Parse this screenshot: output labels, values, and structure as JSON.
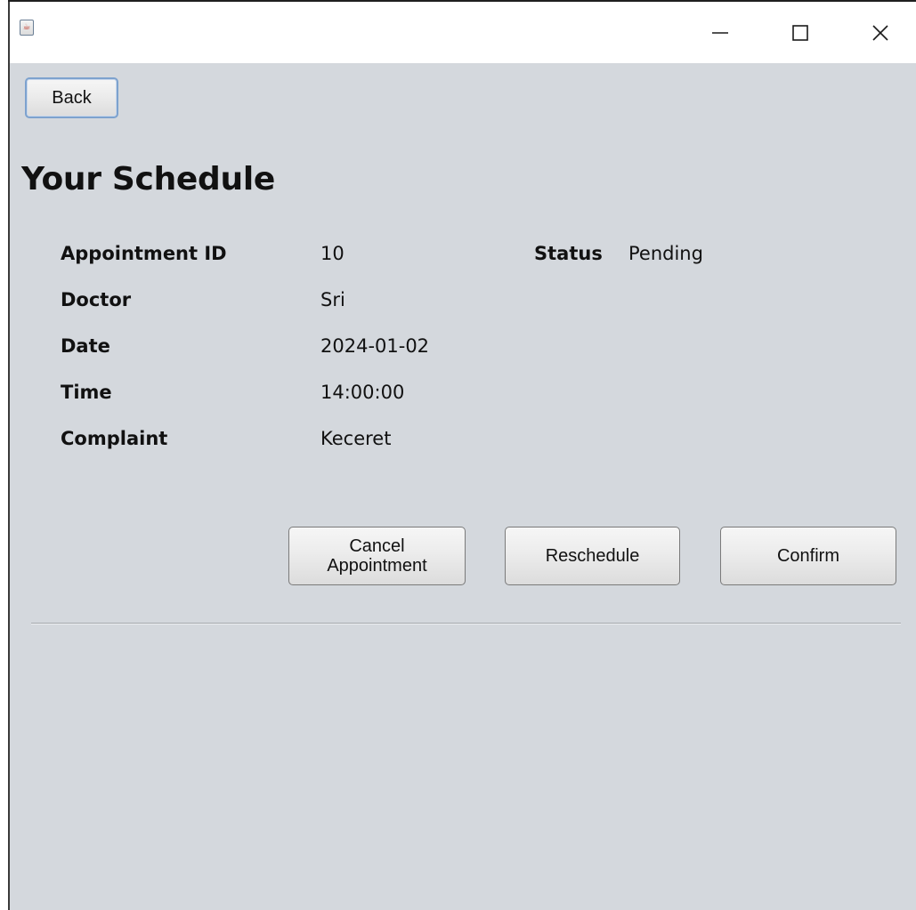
{
  "window": {
    "title": "",
    "app_icon": "java-coffee-cup-icon",
    "controls": {
      "minimize_icon": "minimize-icon",
      "maximize_icon": "maximize-icon",
      "close_icon": "close-icon"
    }
  },
  "toolbar": {
    "back_label": "Back"
  },
  "page": {
    "title": "Your Schedule"
  },
  "appointment": {
    "id_label": "Appointment ID",
    "id_value": "10",
    "status_label": "Status",
    "status_value": "Pending",
    "doctor_label": "Doctor",
    "doctor_value": "Sri",
    "date_label": "Date",
    "date_value": "2024-01-02",
    "time_label": "Time",
    "time_value": "14:00:00",
    "complaint_label": "Complaint",
    "complaint_value": "Keceret"
  },
  "actions": {
    "cancel_label_line1": "Cancel",
    "cancel_label_line2": "Appointment",
    "reschedule_label": "Reschedule",
    "confirm_label": "Confirm"
  },
  "colors": {
    "content_background": "#d4d8dd",
    "titlebar_background": "#ffffff",
    "back_button_focus_border": "#7da2ce"
  }
}
